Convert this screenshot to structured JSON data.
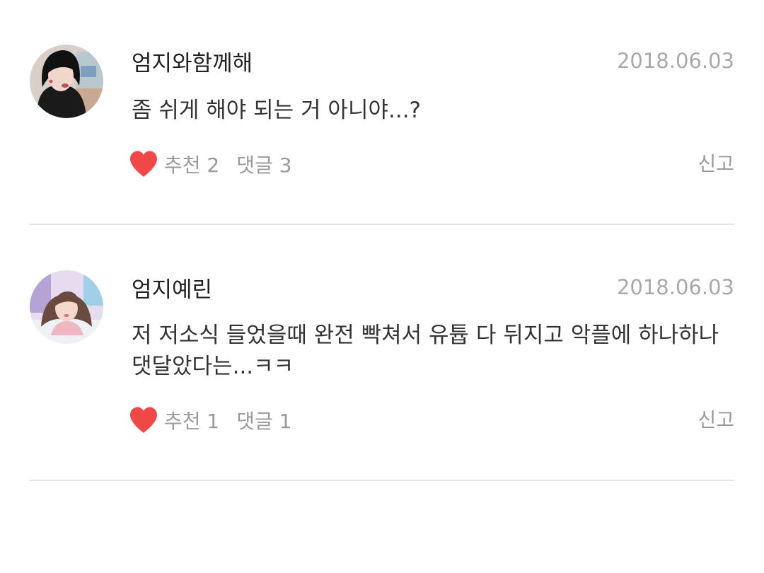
{
  "colors": {
    "heart": "#f04747",
    "meta_text": "#9a9a9a",
    "date_text": "#a9a9a9",
    "divider": "#e6e6e6"
  },
  "comments": [
    {
      "author": "엄지와함께해",
      "date": "2018.06.03",
      "text": "좀 쉬게 해야 되는 거 아니야...?",
      "like_label": "추천 2",
      "reply_label": "댓글 3",
      "report_label": "신고",
      "avatar_icon": "profile-photo-avatar",
      "like_icon": "heart-icon"
    },
    {
      "author": "엄지예린",
      "date": "2018.06.03",
      "text": "저 저소식 들었을때 완전 빡쳐서 유튭 다 뒤지고 악플에 하나하나 댓달았다는...ㅋㅋ",
      "like_label": "추천 1",
      "reply_label": "댓글 1",
      "report_label": "신고",
      "avatar_icon": "profile-photo-avatar",
      "like_icon": "heart-icon"
    }
  ]
}
